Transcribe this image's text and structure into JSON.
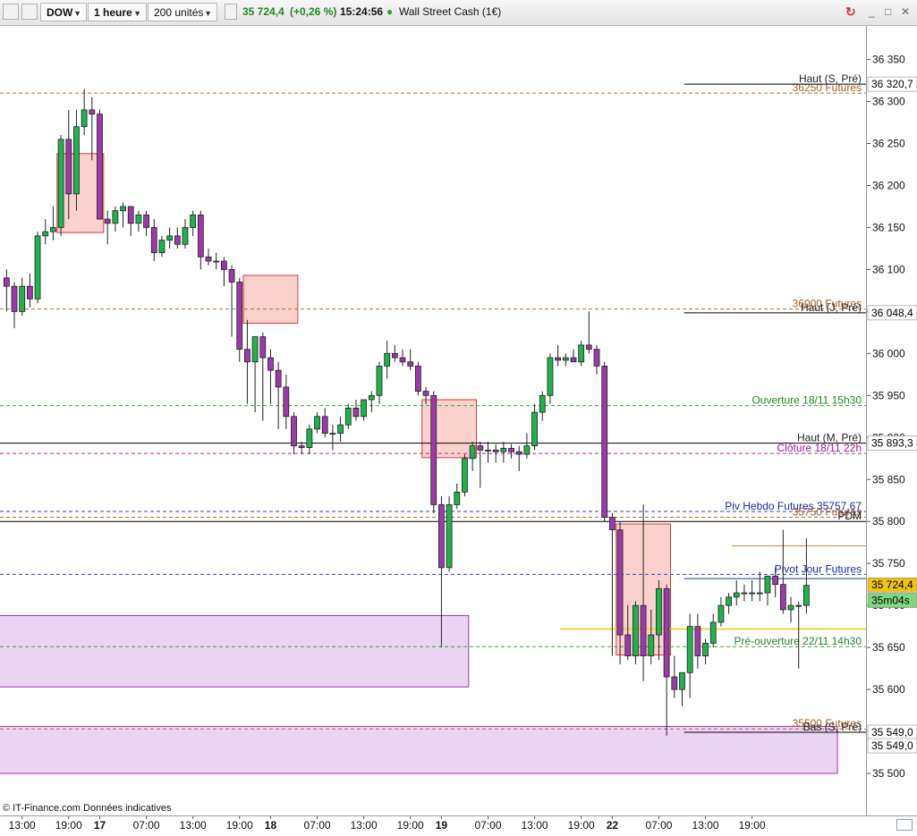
{
  "toolbar": {
    "symbol": "DOW",
    "timeframe": "1 heure",
    "units": "200 unités",
    "price": "35 724,4",
    "change": "(+0,26 %)",
    "time": "15:24:56",
    "instrument": "Wall Street Cash (1€)"
  },
  "footer": {
    "source": "© IT-Finance.com  Données indicatives"
  },
  "chart_data": {
    "type": "candlestick",
    "y_range": [
      35450,
      36390
    ],
    "y_ticks": [
      {
        "value": 36350,
        "label": "36 350"
      },
      {
        "value": 36300,
        "label": "36 300"
      },
      {
        "value": 36250,
        "label": "36 250"
      },
      {
        "value": 36200,
        "label": "36 200"
      },
      {
        "value": 36150,
        "label": "36 150"
      },
      {
        "value": 36100,
        "label": "36 100"
      },
      {
        "value": 36050,
        "label": "36 050"
      },
      {
        "value": 36000,
        "label": "36 000"
      },
      {
        "value": 35950,
        "label": "35 950"
      },
      {
        "value": 35900,
        "label": "35 900"
      },
      {
        "value": 35850,
        "label": "35 850"
      },
      {
        "value": 35800,
        "label": "35 800"
      },
      {
        "value": 35750,
        "label": "35 750"
      },
      {
        "value": 35700,
        "label": "35 700"
      },
      {
        "value": 35650,
        "label": "35 650"
      },
      {
        "value": 35600,
        "label": "35 600"
      },
      {
        "value": 35550,
        "label": "35 550"
      },
      {
        "value": 35500,
        "label": "35 500"
      }
    ],
    "x_labels": [
      "13:00",
      "19:00",
      "17",
      "07:00",
      "13:00",
      "19:00",
      "18",
      "07:00",
      "13:00",
      "19:00",
      "19",
      "07:00",
      "13:00",
      "19:00",
      "22",
      "07:00",
      "13:00",
      "19:00"
    ],
    "x_label_bold": [
      false,
      false,
      true,
      false,
      false,
      false,
      true,
      false,
      false,
      false,
      true,
      false,
      false,
      false,
      true,
      false,
      false,
      false
    ],
    "x_label_index": [
      2,
      8,
      12,
      18,
      24,
      30,
      34,
      40,
      46,
      52,
      56,
      62,
      68,
      74,
      78,
      84,
      90,
      96
    ],
    "candles": [
      {
        "o": 36090,
        "h": 36100,
        "l": 36050,
        "c": 36080
      },
      {
        "o": 36080,
        "h": 36085,
        "l": 36030,
        "c": 36050
      },
      {
        "o": 36050,
        "h": 36090,
        "l": 36045,
        "c": 36080
      },
      {
        "o": 36080,
        "h": 36095,
        "l": 36055,
        "c": 36065
      },
      {
        "o": 36065,
        "h": 36145,
        "l": 36060,
        "c": 36140
      },
      {
        "o": 36140,
        "h": 36160,
        "l": 36130,
        "c": 36145
      },
      {
        "o": 36145,
        "h": 36175,
        "l": 36135,
        "c": 36150
      },
      {
        "o": 36150,
        "h": 36260,
        "l": 36140,
        "c": 36255
      },
      {
        "o": 36255,
        "h": 36290,
        "l": 36160,
        "c": 36190
      },
      {
        "o": 36190,
        "h": 36290,
        "l": 36170,
        "c": 36270
      },
      {
        "o": 36270,
        "h": 36315,
        "l": 36260,
        "c": 36290
      },
      {
        "o": 36290,
        "h": 36305,
        "l": 36230,
        "c": 36285
      },
      {
        "o": 36285,
        "h": 36290,
        "l": 36190,
        "c": 36160
      },
      {
        "o": 36160,
        "h": 36170,
        "l": 36130,
        "c": 36155
      },
      {
        "o": 36155,
        "h": 36175,
        "l": 36145,
        "c": 36170
      },
      {
        "o": 36170,
        "h": 36180,
        "l": 36150,
        "c": 36175
      },
      {
        "o": 36175,
        "h": 36175,
        "l": 36140,
        "c": 36155
      },
      {
        "o": 36155,
        "h": 36170,
        "l": 36145,
        "c": 36165
      },
      {
        "o": 36165,
        "h": 36170,
        "l": 36140,
        "c": 36150
      },
      {
        "o": 36150,
        "h": 36160,
        "l": 36110,
        "c": 36120
      },
      {
        "o": 36120,
        "h": 36140,
        "l": 36115,
        "c": 36135
      },
      {
        "o": 36135,
        "h": 36150,
        "l": 36125,
        "c": 36140
      },
      {
        "o": 36140,
        "h": 36150,
        "l": 36125,
        "c": 36130
      },
      {
        "o": 36130,
        "h": 36160,
        "l": 36125,
        "c": 36150
      },
      {
        "o": 36150,
        "h": 36170,
        "l": 36140,
        "c": 36165
      },
      {
        "o": 36165,
        "h": 36170,
        "l": 36100,
        "c": 36115
      },
      {
        "o": 36115,
        "h": 36125,
        "l": 36105,
        "c": 36110
      },
      {
        "o": 36110,
        "h": 36120,
        "l": 36100,
        "c": 36110
      },
      {
        "o": 36110,
        "h": 36115,
        "l": 36080,
        "c": 36100
      },
      {
        "o": 36100,
        "h": 36105,
        "l": 36020,
        "c": 36085
      },
      {
        "o": 36085,
        "h": 36090,
        "l": 35990,
        "c": 36005
      },
      {
        "o": 36005,
        "h": 36040,
        "l": 35940,
        "c": 35990
      },
      {
        "o": 35990,
        "h": 36015,
        "l": 35930,
        "c": 36020
      },
      {
        "o": 36020,
        "h": 36025,
        "l": 35920,
        "c": 35995
      },
      {
        "o": 35995,
        "h": 36005,
        "l": 35940,
        "c": 35980
      },
      {
        "o": 35980,
        "h": 35990,
        "l": 35910,
        "c": 35960
      },
      {
        "o": 35960,
        "h": 35975,
        "l": 35910,
        "c": 35925
      },
      {
        "o": 35925,
        "h": 35930,
        "l": 35880,
        "c": 35890
      },
      {
        "o": 35890,
        "h": 35895,
        "l": 35880,
        "c": 35888
      },
      {
        "o": 35888,
        "h": 35915,
        "l": 35880,
        "c": 35910
      },
      {
        "o": 35910,
        "h": 35930,
        "l": 35905,
        "c": 35925
      },
      {
        "o": 35925,
        "h": 35935,
        "l": 35900,
        "c": 35905
      },
      {
        "o": 35905,
        "h": 35915,
        "l": 35885,
        "c": 35905
      },
      {
        "o": 35905,
        "h": 35925,
        "l": 35895,
        "c": 35915
      },
      {
        "o": 35915,
        "h": 35940,
        "l": 35910,
        "c": 35935
      },
      {
        "o": 35935,
        "h": 35945,
        "l": 35920,
        "c": 35925
      },
      {
        "o": 35925,
        "h": 35945,
        "l": 35920,
        "c": 35945
      },
      {
        "o": 35945,
        "h": 35955,
        "l": 35930,
        "c": 35950
      },
      {
        "o": 35950,
        "h": 35990,
        "l": 35940,
        "c": 35985
      },
      {
        "o": 35985,
        "h": 36015,
        "l": 35970,
        "c": 36000
      },
      {
        "o": 36000,
        "h": 36010,
        "l": 35990,
        "c": 35995
      },
      {
        "o": 35995,
        "h": 36005,
        "l": 35985,
        "c": 35990
      },
      {
        "o": 35990,
        "h": 36005,
        "l": 35980,
        "c": 35985
      },
      {
        "o": 35985,
        "h": 35990,
        "l": 35950,
        "c": 35955
      },
      {
        "o": 35955,
        "h": 35960,
        "l": 35940,
        "c": 35950
      },
      {
        "o": 35950,
        "h": 35955,
        "l": 35810,
        "c": 35820
      },
      {
        "o": 35820,
        "h": 35830,
        "l": 35650,
        "c": 35745
      },
      {
        "o": 35745,
        "h": 35830,
        "l": 35740,
        "c": 35820
      },
      {
        "o": 35820,
        "h": 35845,
        "l": 35815,
        "c": 35835
      },
      {
        "o": 35835,
        "h": 35880,
        "l": 35830,
        "c": 35875
      },
      {
        "o": 35875,
        "h": 35895,
        "l": 35860,
        "c": 35890
      },
      {
        "o": 35890,
        "h": 35895,
        "l": 35840,
        "c": 35885
      },
      {
        "o": 35885,
        "h": 35895,
        "l": 35870,
        "c": 35885
      },
      {
        "o": 35885,
        "h": 35892,
        "l": 35870,
        "c": 35883
      },
      {
        "o": 35883,
        "h": 35895,
        "l": 35870,
        "c": 35887
      },
      {
        "o": 35887,
        "h": 35892,
        "l": 35875,
        "c": 35883
      },
      {
        "o": 35883,
        "h": 35890,
        "l": 35860,
        "c": 35880
      },
      {
        "o": 35880,
        "h": 35905,
        "l": 35875,
        "c": 35890
      },
      {
        "o": 35890,
        "h": 35940,
        "l": 35885,
        "c": 35930
      },
      {
        "o": 35930,
        "h": 35955,
        "l": 35920,
        "c": 35950
      },
      {
        "o": 35950,
        "h": 36000,
        "l": 35940,
        "c": 35995
      },
      {
        "o": 35995,
        "h": 36010,
        "l": 35985,
        "c": 35992
      },
      {
        "o": 35992,
        "h": 36000,
        "l": 35985,
        "c": 35995
      },
      {
        "o": 35995,
        "h": 36005,
        "l": 35990,
        "c": 35990
      },
      {
        "o": 35990,
        "h": 36015,
        "l": 35985,
        "c": 36010
      },
      {
        "o": 36010,
        "h": 36050,
        "l": 36000,
        "c": 36005
      },
      {
        "o": 36005,
        "h": 36010,
        "l": 35975,
        "c": 35985
      },
      {
        "o": 35985,
        "h": 35990,
        "l": 35800,
        "c": 35805
      },
      {
        "o": 35805,
        "h": 35810,
        "l": 35640,
        "c": 35790
      },
      {
        "o": 35790,
        "h": 35800,
        "l": 35630,
        "c": 35665
      },
      {
        "o": 35665,
        "h": 35700,
        "l": 35635,
        "c": 35640
      },
      {
        "o": 35640,
        "h": 35705,
        "l": 35630,
        "c": 35700
      },
      {
        "o": 35700,
        "h": 35820,
        "l": 35610,
        "c": 35640
      },
      {
        "o": 35640,
        "h": 35695,
        "l": 35630,
        "c": 35665
      },
      {
        "o": 35665,
        "h": 35730,
        "l": 35635,
        "c": 35720
      },
      {
        "o": 35720,
        "h": 35725,
        "l": 35545,
        "c": 35615
      },
      {
        "o": 35615,
        "h": 35640,
        "l": 35590,
        "c": 35600
      },
      {
        "o": 35600,
        "h": 35620,
        "l": 35580,
        "c": 35620
      },
      {
        "o": 35620,
        "h": 35690,
        "l": 35590,
        "c": 35675
      },
      {
        "o": 35675,
        "h": 35690,
        "l": 35625,
        "c": 35640
      },
      {
        "o": 35640,
        "h": 35660,
        "l": 35630,
        "c": 35655
      },
      {
        "o": 35655,
        "h": 35690,
        "l": 35650,
        "c": 35680
      },
      {
        "o": 35680,
        "h": 35710,
        "l": 35675,
        "c": 35700
      },
      {
        "o": 35700,
        "h": 35715,
        "l": 35690,
        "c": 35710
      },
      {
        "o": 35710,
        "h": 35730,
        "l": 35700,
        "c": 35715
      },
      {
        "o": 35715,
        "h": 35725,
        "l": 35705,
        "c": 35715
      },
      {
        "o": 35715,
        "h": 35730,
        "l": 35705,
        "c": 35715
      },
      {
        "o": 35715,
        "h": 35740,
        "l": 35705,
        "c": 35715
      },
      {
        "o": 35715,
        "h": 35735,
        "l": 35700,
        "c": 35735
      },
      {
        "o": 35735,
        "h": 35745,
        "l": 35710,
        "c": 35725
      },
      {
        "o": 35725,
        "h": 35790,
        "l": 35690,
        "c": 35695
      },
      {
        "o": 35695,
        "h": 35710,
        "l": 35680,
        "c": 35700
      },
      {
        "o": 35700,
        "h": 35705,
        "l": 35625,
        "c": 35700
      },
      {
        "o": 35700,
        "h": 35780,
        "l": 35690,
        "c": 35724
      }
    ],
    "hlines": [
      {
        "value": 36310,
        "style": "dashed",
        "color": "#b07030",
        "x0": 0,
        "label": "36250 Futures",
        "label_color": "#a0602a"
      },
      {
        "value": 36320.7,
        "style": "solid",
        "color": "#000000",
        "x0": 0.79,
        "label": "Haut (S, Pré)",
        "label_color": "#222222"
      },
      {
        "value": 36053,
        "style": "dashed",
        "color": "#b07030",
        "x0": 0,
        "label": "36000 Futures",
        "label_color": "#a0602a"
      },
      {
        "value": 36048.4,
        "style": "solid",
        "color": "#000000",
        "x0": 0.79,
        "label": "Haut (J, Pré)",
        "label_color": "#222222"
      },
      {
        "value": 35938,
        "style": "dashed",
        "color": "#33aa33",
        "x0": 0,
        "label": "Ouverture 18/11 15h30",
        "label_color": "#228822"
      },
      {
        "value": 35893.3,
        "style": "solid",
        "color": "#000000",
        "x0": 0,
        "label": "Haut (M, Pré)",
        "label_color": "#222222"
      },
      {
        "value": 35881,
        "style": "dashed",
        "color": "#aa33aa",
        "x0": 0,
        "label": "Clôture 18/11 22h",
        "label_color": "#992299"
      },
      {
        "value": 35812,
        "style": "dashed",
        "color": "#3344aa",
        "x0": 0,
        "label": "Piv Hebdo Futures 35757,67",
        "label_color": "#1a2aa8"
      },
      {
        "value": 35805,
        "style": "dashed",
        "color": "#b07030",
        "x0": 0,
        "label": "35750 Futures",
        "label_color": "#a0602a"
      },
      {
        "value": 35800,
        "style": "solid",
        "color": "#000000",
        "x0": 0,
        "label": "PDM",
        "label_color": "#222222"
      },
      {
        "value": 35771,
        "style": "solid",
        "color": "#c89040",
        "x0": 0.845,
        "label": "",
        "label_color": "#222222"
      },
      {
        "value": 35737,
        "style": "dashed",
        "color": "#3344cc",
        "x0": 0,
        "label": "Pivot Jour Futures",
        "label_color": "#1a2aa8"
      },
      {
        "value": 35732,
        "style": "solid",
        "color": "#1a3aa8",
        "x0": 0.79,
        "label": "",
        "label_color": "#222222"
      },
      {
        "value": 35672,
        "style": "solid",
        "color": "#e8d840",
        "x0": 0.647,
        "label": "",
        "label_color": "#222222"
      },
      {
        "value": 35651,
        "style": "dashed",
        "color": "#33aa33",
        "x0": 0,
        "label": "Pré-ouverture 22/11 14h30",
        "label_color": "#228822"
      },
      {
        "value": 35553,
        "style": "dashed",
        "color": "#b07030",
        "x0": 0,
        "label": "35500 Futures",
        "label_color": "#a0602a"
      },
      {
        "value": 35549,
        "style": "solid",
        "color": "#000000",
        "x0": 0.79,
        "label": "Bas (S, Pré)",
        "label_color": "#222222"
      }
    ],
    "zones": [
      {
        "i0": 6.5,
        "i1": 12.5,
        "top": 36238,
        "bottom": 36144,
        "kind": "red"
      },
      {
        "i0": 30.5,
        "i1": 37.5,
        "top": 36093,
        "bottom": 36036,
        "kind": "red"
      },
      {
        "i0": 53.5,
        "i1": 60.5,
        "top": 35945,
        "bottom": 35876,
        "kind": "red"
      },
      {
        "i0": 78.5,
        "i1": 85.5,
        "top": 35797,
        "bottom": 35641,
        "kind": "red"
      },
      {
        "i0": -1,
        "i1": 59.5,
        "top": 35688,
        "bottom": 35603,
        "kind": "purple"
      },
      {
        "i0": -1,
        "i1": 107,
        "top": 35556,
        "bottom": 35500,
        "kind": "purple"
      }
    ],
    "price_tags": [
      {
        "value": 36320.7,
        "text": "36 320,7",
        "bg": "#ffffff",
        "fg": "#000000"
      },
      {
        "value": 36048.4,
        "text": "36 048,4",
        "bg": "#ffffff",
        "fg": "#000000"
      },
      {
        "value": 35893.3,
        "text": "35 893,3",
        "bg": "#ffffff",
        "fg": "#000000"
      },
      {
        "value": 35724.4,
        "text": "35 724,4",
        "bg": "#f2c21a",
        "fg": "#000000"
      },
      {
        "value": 35706,
        "text": "35m04s",
        "bg": "#7fd77f",
        "fg": "#000000"
      },
      {
        "value": 35549,
        "text": "35 549,0",
        "bg": "#ffffff",
        "fg": "#000000"
      },
      {
        "value": 35533,
        "text": "35 549,0",
        "bg": "#ffffff",
        "fg": "#000000"
      }
    ]
  }
}
